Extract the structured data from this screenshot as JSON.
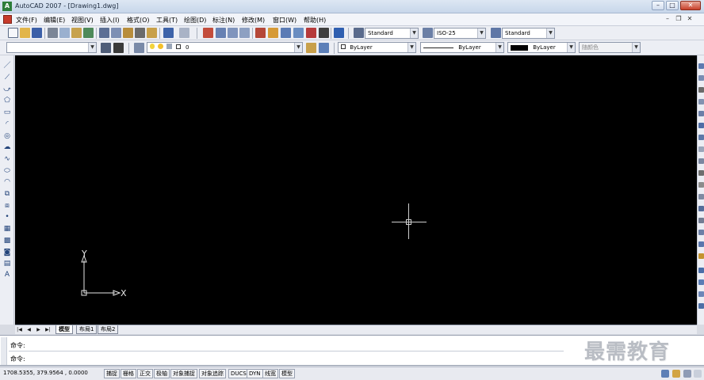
{
  "window": {
    "title": "AutoCAD 2007 - [Drawing1.dwg]",
    "app_icon_text": "A",
    "minimize": "–",
    "maximize": "□",
    "close": "✕"
  },
  "menu": {
    "items": [
      "文件(F)",
      "编辑(E)",
      "视图(V)",
      "插入(I)",
      "格式(O)",
      "工具(T)",
      "绘图(D)",
      "标注(N)",
      "修改(M)",
      "窗口(W)",
      "帮助(H)"
    ],
    "mdi_minimize": "–",
    "mdi_restore": "❐",
    "mdi_close": "✕"
  },
  "styles_toolbar": {
    "text_style": "Standard",
    "dim_style": "ISO-25",
    "table_style": "Standard"
  },
  "properties_toolbar": {
    "layer_value": "0",
    "color": "ByLayer",
    "linetype": "ByLayer",
    "lineweight": "ByLayer",
    "plot_style": "随颜色"
  },
  "canvas": {
    "background": "#000000",
    "ucs_x_label": "X",
    "ucs_y_label": "Y"
  },
  "layout_tabs": {
    "nav_first": "|◀",
    "nav_prev": "◀",
    "nav_next": "▶",
    "nav_last": "▶|",
    "tabs": [
      "模型",
      "布局1",
      "布局2"
    ]
  },
  "command": {
    "line1": "命令:",
    "line2": "命令:"
  },
  "watermark": "最需教育",
  "statusbar": {
    "coordinates": "1708.5355,  379.9564 ,  0.0000",
    "toggles": [
      "捕捉",
      "栅格",
      "正交",
      "极轴",
      "对象捕捉",
      "对象追踪",
      "DUCS",
      "DYN",
      "线宽",
      "模型"
    ]
  },
  "colors": {
    "canvas": "#000000",
    "crosshair": "#cfcfcf",
    "toolbar": "#eceef4",
    "watermark": "#b9bdc4"
  }
}
